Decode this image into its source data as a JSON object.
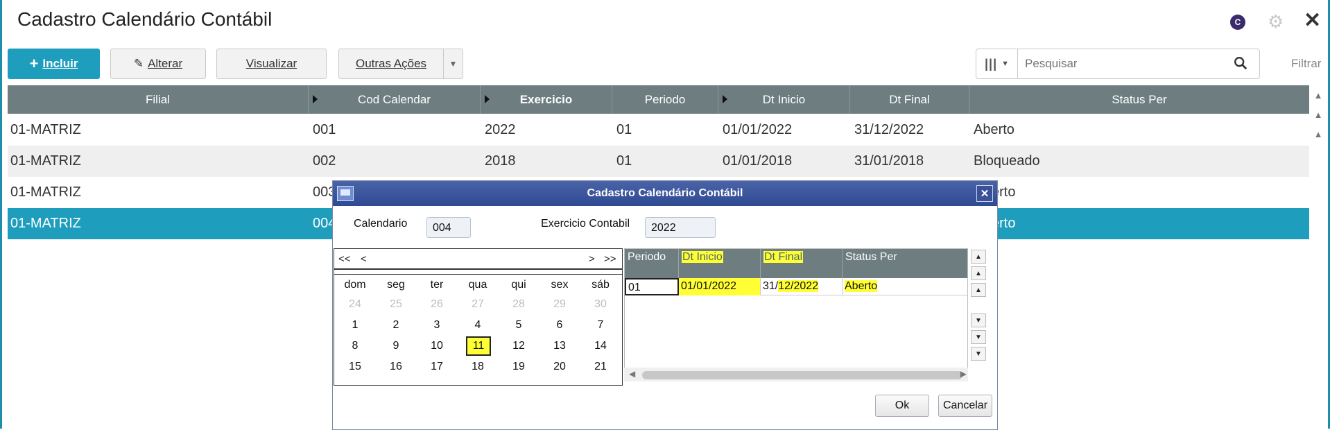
{
  "header": {
    "title": "Cadastro Calendário Contábil",
    "avatar_letter": "C"
  },
  "toolbar": {
    "incluir": "Incluir",
    "alterar": "Alterar",
    "visualizar": "Visualizar",
    "outras_acoes": "Outras Ações",
    "search_placeholder": "Pesquisar",
    "filtrar": "Filtrar"
  },
  "grid": {
    "columns": [
      "Filial",
      "Cod Calendar",
      "Exercicio",
      "Periodo",
      "Dt Inicio",
      "Dt Final",
      "Status Per"
    ],
    "rows": [
      [
        "01-MATRIZ",
        "001",
        "2022",
        "01",
        "01/01/2022",
        "31/12/2022",
        "Aberto"
      ],
      [
        "01-MATRIZ",
        "002",
        "2018",
        "01",
        "01/01/2018",
        "31/01/2018",
        "Bloqueado"
      ],
      [
        "01-MATRIZ",
        "003",
        "",
        "",
        "",
        "",
        "erto"
      ],
      [
        "01-MATRIZ",
        "004",
        "",
        "",
        "",
        "",
        "erto"
      ]
    ],
    "selected_row": 3
  },
  "dialog": {
    "title": "Cadastro Calendário Contábil",
    "calendario_label": "Calendario",
    "calendario_value": "004",
    "exercicio_label": "Exercicio Contabil",
    "exercicio_value": "2022",
    "calendar": {
      "nav_prev2": "<<",
      "nav_prev": "<",
      "nav_next": ">",
      "nav_next2": ">>",
      "weekdays": [
        "dom",
        "seg",
        "ter",
        "qua",
        "qui",
        "sex",
        "sáb"
      ],
      "weeks": [
        [
          "24",
          "25",
          "26",
          "27",
          "28",
          "29",
          "30"
        ],
        [
          "1",
          "2",
          "3",
          "4",
          "5",
          "6",
          "7"
        ],
        [
          "8",
          "9",
          "10",
          "11",
          "12",
          "13",
          "14"
        ],
        [
          "15",
          "16",
          "17",
          "18",
          "19",
          "20",
          "21"
        ]
      ],
      "today": "11"
    },
    "periods": {
      "columns": [
        "Periodo",
        "Dt Inicio",
        "Dt Final",
        "Status Per"
      ],
      "row": [
        "01",
        "01/01/2022",
        "31/",
        "12/2022",
        "Aberto"
      ]
    },
    "ok": "Ok",
    "cancelar": "Cancelar"
  },
  "colors": {
    "accent": "#1e9dbc",
    "header_gray": "#6d7d80",
    "highlight": "#ffff33",
    "dialog_title": "#2e4a92"
  }
}
